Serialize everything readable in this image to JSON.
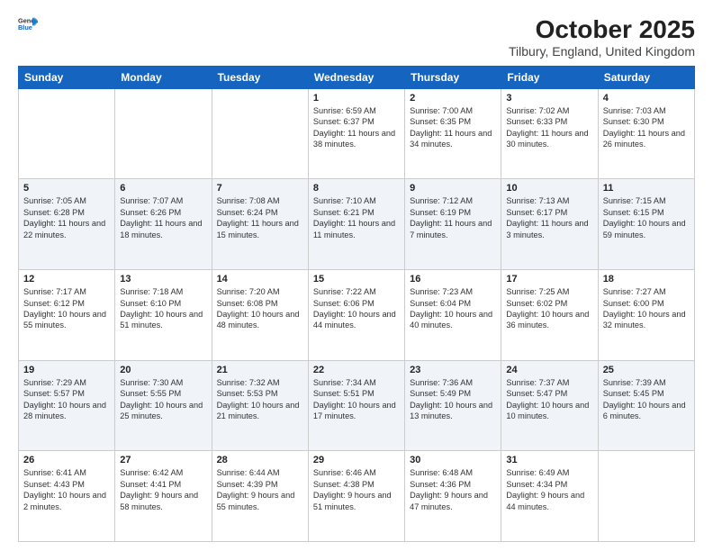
{
  "logo": {
    "general": "General",
    "blue": "Blue"
  },
  "title": "October 2025",
  "location": "Tilbury, England, United Kingdom",
  "days_header": [
    "Sunday",
    "Monday",
    "Tuesday",
    "Wednesday",
    "Thursday",
    "Friday",
    "Saturday"
  ],
  "weeks": [
    [
      {
        "day": "",
        "text": ""
      },
      {
        "day": "",
        "text": ""
      },
      {
        "day": "",
        "text": ""
      },
      {
        "day": "1",
        "text": "Sunrise: 6:59 AM\nSunset: 6:37 PM\nDaylight: 11 hours\nand 38 minutes."
      },
      {
        "day": "2",
        "text": "Sunrise: 7:00 AM\nSunset: 6:35 PM\nDaylight: 11 hours\nand 34 minutes."
      },
      {
        "day": "3",
        "text": "Sunrise: 7:02 AM\nSunset: 6:33 PM\nDaylight: 11 hours\nand 30 minutes."
      },
      {
        "day": "4",
        "text": "Sunrise: 7:03 AM\nSunset: 6:30 PM\nDaylight: 11 hours\nand 26 minutes."
      }
    ],
    [
      {
        "day": "5",
        "text": "Sunrise: 7:05 AM\nSunset: 6:28 PM\nDaylight: 11 hours\nand 22 minutes."
      },
      {
        "day": "6",
        "text": "Sunrise: 7:07 AM\nSunset: 6:26 PM\nDaylight: 11 hours\nand 18 minutes."
      },
      {
        "day": "7",
        "text": "Sunrise: 7:08 AM\nSunset: 6:24 PM\nDaylight: 11 hours\nand 15 minutes."
      },
      {
        "day": "8",
        "text": "Sunrise: 7:10 AM\nSunset: 6:21 PM\nDaylight: 11 hours\nand 11 minutes."
      },
      {
        "day": "9",
        "text": "Sunrise: 7:12 AM\nSunset: 6:19 PM\nDaylight: 11 hours\nand 7 minutes."
      },
      {
        "day": "10",
        "text": "Sunrise: 7:13 AM\nSunset: 6:17 PM\nDaylight: 11 hours\nand 3 minutes."
      },
      {
        "day": "11",
        "text": "Sunrise: 7:15 AM\nSunset: 6:15 PM\nDaylight: 10 hours\nand 59 minutes."
      }
    ],
    [
      {
        "day": "12",
        "text": "Sunrise: 7:17 AM\nSunset: 6:12 PM\nDaylight: 10 hours\nand 55 minutes."
      },
      {
        "day": "13",
        "text": "Sunrise: 7:18 AM\nSunset: 6:10 PM\nDaylight: 10 hours\nand 51 minutes."
      },
      {
        "day": "14",
        "text": "Sunrise: 7:20 AM\nSunset: 6:08 PM\nDaylight: 10 hours\nand 48 minutes."
      },
      {
        "day": "15",
        "text": "Sunrise: 7:22 AM\nSunset: 6:06 PM\nDaylight: 10 hours\nand 44 minutes."
      },
      {
        "day": "16",
        "text": "Sunrise: 7:23 AM\nSunset: 6:04 PM\nDaylight: 10 hours\nand 40 minutes."
      },
      {
        "day": "17",
        "text": "Sunrise: 7:25 AM\nSunset: 6:02 PM\nDaylight: 10 hours\nand 36 minutes."
      },
      {
        "day": "18",
        "text": "Sunrise: 7:27 AM\nSunset: 6:00 PM\nDaylight: 10 hours\nand 32 minutes."
      }
    ],
    [
      {
        "day": "19",
        "text": "Sunrise: 7:29 AM\nSunset: 5:57 PM\nDaylight: 10 hours\nand 28 minutes."
      },
      {
        "day": "20",
        "text": "Sunrise: 7:30 AM\nSunset: 5:55 PM\nDaylight: 10 hours\nand 25 minutes."
      },
      {
        "day": "21",
        "text": "Sunrise: 7:32 AM\nSunset: 5:53 PM\nDaylight: 10 hours\nand 21 minutes."
      },
      {
        "day": "22",
        "text": "Sunrise: 7:34 AM\nSunset: 5:51 PM\nDaylight: 10 hours\nand 17 minutes."
      },
      {
        "day": "23",
        "text": "Sunrise: 7:36 AM\nSunset: 5:49 PM\nDaylight: 10 hours\nand 13 minutes."
      },
      {
        "day": "24",
        "text": "Sunrise: 7:37 AM\nSunset: 5:47 PM\nDaylight: 10 hours\nand 10 minutes."
      },
      {
        "day": "25",
        "text": "Sunrise: 7:39 AM\nSunset: 5:45 PM\nDaylight: 10 hours\nand 6 minutes."
      }
    ],
    [
      {
        "day": "26",
        "text": "Sunrise: 6:41 AM\nSunset: 4:43 PM\nDaylight: 10 hours\nand 2 minutes."
      },
      {
        "day": "27",
        "text": "Sunrise: 6:42 AM\nSunset: 4:41 PM\nDaylight: 9 hours\nand 58 minutes."
      },
      {
        "day": "28",
        "text": "Sunrise: 6:44 AM\nSunset: 4:39 PM\nDaylight: 9 hours\nand 55 minutes."
      },
      {
        "day": "29",
        "text": "Sunrise: 6:46 AM\nSunset: 4:38 PM\nDaylight: 9 hours\nand 51 minutes."
      },
      {
        "day": "30",
        "text": "Sunrise: 6:48 AM\nSunset: 4:36 PM\nDaylight: 9 hours\nand 47 minutes."
      },
      {
        "day": "31",
        "text": "Sunrise: 6:49 AM\nSunset: 4:34 PM\nDaylight: 9 hours\nand 44 minutes."
      },
      {
        "day": "",
        "text": ""
      }
    ]
  ]
}
